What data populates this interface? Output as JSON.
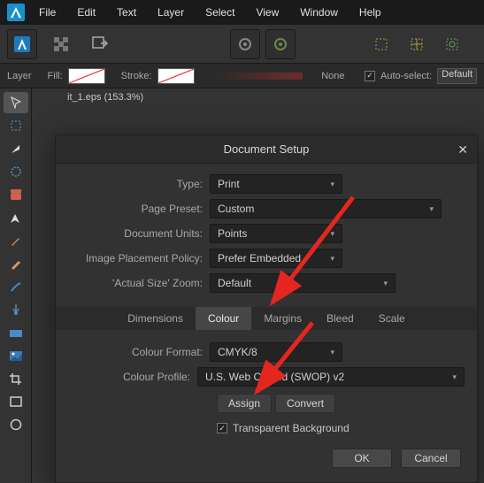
{
  "menubar": {
    "items": [
      "File",
      "Edit",
      "Text",
      "Layer",
      "Select",
      "View",
      "Window",
      "Help"
    ]
  },
  "contextbar": {
    "layer_label": "Layer",
    "fill_label": "Fill:",
    "stroke_label": "Stroke:",
    "opacity_value": "None",
    "autoselect_label": "Auto-select:",
    "autoselect_value": "Default"
  },
  "document": {
    "tab_label": "it_1.eps (153.3%)"
  },
  "dialog": {
    "title": "Document Setup",
    "rows": {
      "type": {
        "label": "Type:",
        "value": "Print"
      },
      "page_preset": {
        "label": "Page Preset:",
        "value": "Custom"
      },
      "units": {
        "label": "Document Units:",
        "value": "Points"
      },
      "placement": {
        "label": "Image Placement Policy:",
        "value": "Prefer Embedded"
      },
      "actual_zoom": {
        "label": "'Actual Size' Zoom:",
        "value": "Default"
      },
      "colour_format": {
        "label": "Colour Format:",
        "value": "CMYK/8"
      },
      "colour_profile": {
        "label": "Colour Profile:",
        "value": "U.S. Web Coated (SWOP) v2"
      }
    },
    "tabs": [
      "Dimensions",
      "Colour",
      "Margins",
      "Bleed",
      "Scale"
    ],
    "active_tab": "Colour",
    "assign_btn": "Assign",
    "convert_btn": "Convert",
    "transparent_label": "Transparent Background",
    "ok": "OK",
    "cancel": "Cancel"
  }
}
